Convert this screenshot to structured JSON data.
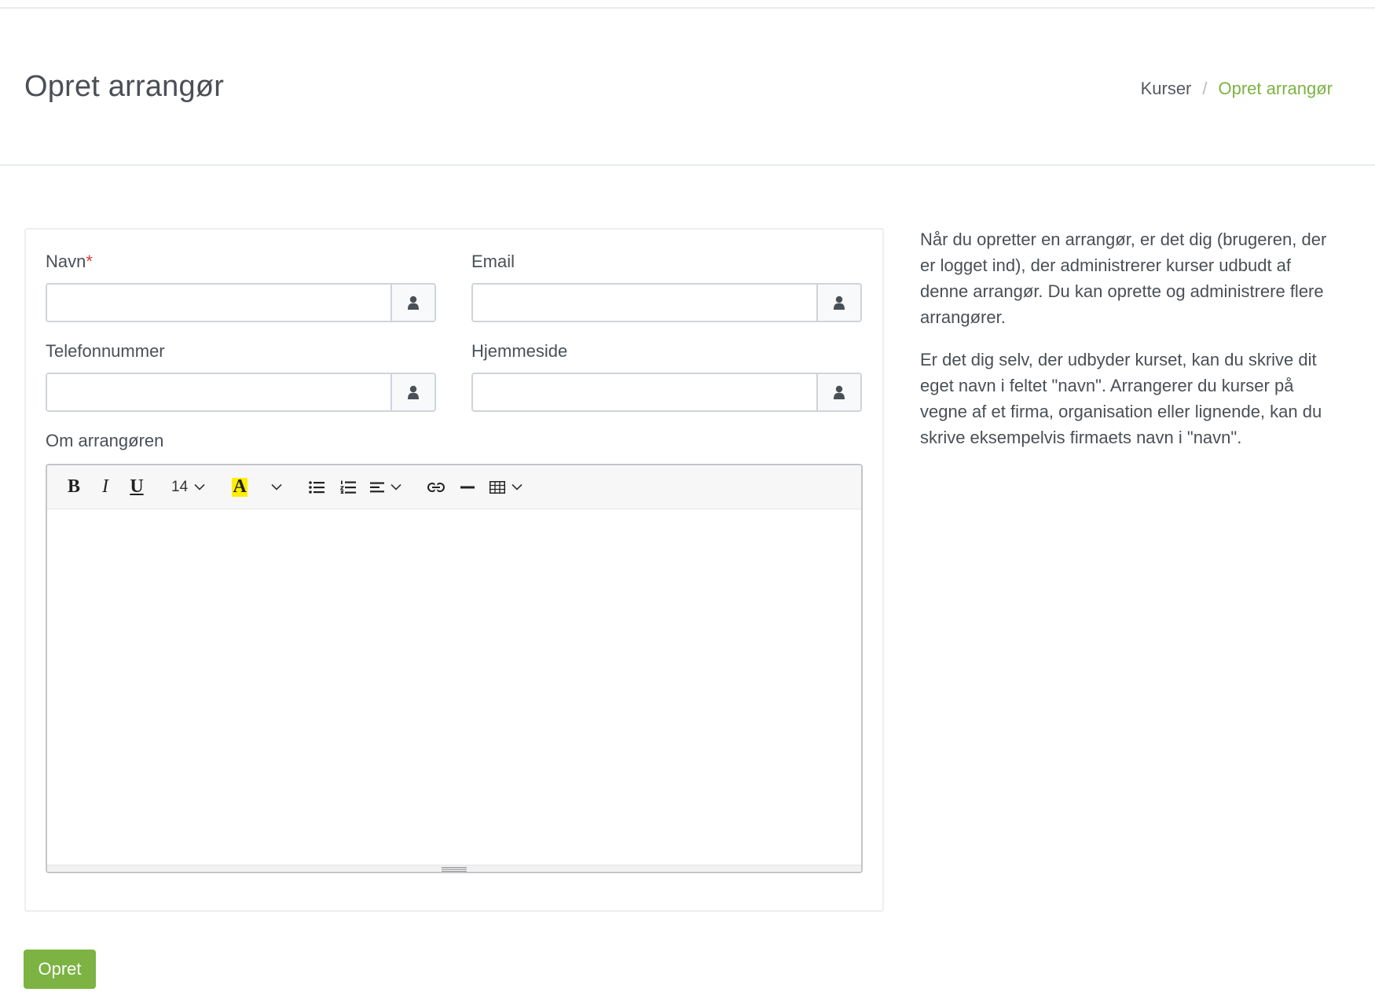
{
  "header": {
    "title": "Opret arrangør",
    "breadcrumb": [
      {
        "label": "Kurser"
      },
      {
        "label": "Opret arrangør"
      }
    ]
  },
  "form": {
    "name_label": "Navn",
    "name_required_mark": "*",
    "name_value": "",
    "email_label": "Email",
    "email_value": "",
    "phone_label": "Telefonnummer",
    "phone_value": "",
    "website_label": "Hjemmeside",
    "website_value": "",
    "about_label": "Om arrangøren",
    "submit_label": "Opret"
  },
  "editor": {
    "bold": "B",
    "italic": "I",
    "underline": "U",
    "font_size": "14",
    "highlight": "A",
    "highlight_color": "#ffee00",
    "icons": [
      "bold-icon",
      "italic-icon",
      "underline-icon",
      "font-size-dropdown",
      "highlight-icon",
      "bullet-list-icon",
      "numbered-list-icon",
      "align-icon",
      "link-icon",
      "horizontal-rule-icon",
      "table-icon"
    ]
  },
  "help": {
    "paragraph_1": "Når du opretter en arrangør, er det dig (brugeren, der er logget ind), der administrerer kurser udbudt af denne arrangør. Du kan oprette og administrere flere arrangører.",
    "paragraph_2": "Er det dig selv, der udbyder kurset, kan du skrive dit eget navn i feltet \"navn\". Arrangerer du kurser på vegne af et firma, organisation eller lignende, kan du skrive eksempelvis firmaets navn i \"navn\"."
  },
  "colors": {
    "accent": "#7cb342",
    "required": "#e53935"
  }
}
